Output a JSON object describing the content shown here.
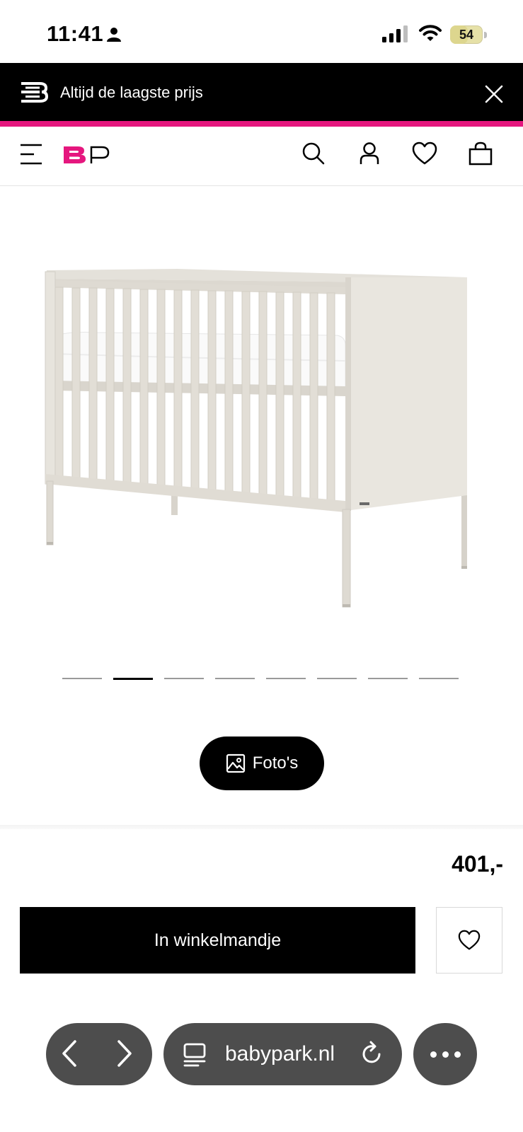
{
  "status_bar": {
    "time": "11:41",
    "battery_level": "54",
    "icons": [
      "person-icon",
      "cellular-signal-icon",
      "wifi-icon",
      "battery-icon"
    ]
  },
  "promo_banner": {
    "text": "Altijd de laagste prijs",
    "icons": [
      "b-logo-icon",
      "close-icon"
    ],
    "background_color": "#000000",
    "accent_color": "#e5177e"
  },
  "header": {
    "logo_letters": [
      "B",
      "P"
    ],
    "logo_color": "#e5177e",
    "icons": [
      "menu-icon",
      "search-icon",
      "account-icon",
      "heart-icon",
      "shopping-bag-icon"
    ]
  },
  "gallery": {
    "image_subject": "crib-image",
    "slide_count": 8,
    "active_slide": 2,
    "photos_button_label": "Foto's",
    "photos_icon": "image-icon"
  },
  "product": {
    "price": "401,-",
    "add_to_cart_label": "In winkelmandje",
    "wishlist_icon": "heart-icon"
  },
  "browser": {
    "domain": "babypark.nl",
    "icons": [
      "back-icon",
      "forward-icon",
      "tabs-icon",
      "reload-icon",
      "more-icon"
    ]
  }
}
